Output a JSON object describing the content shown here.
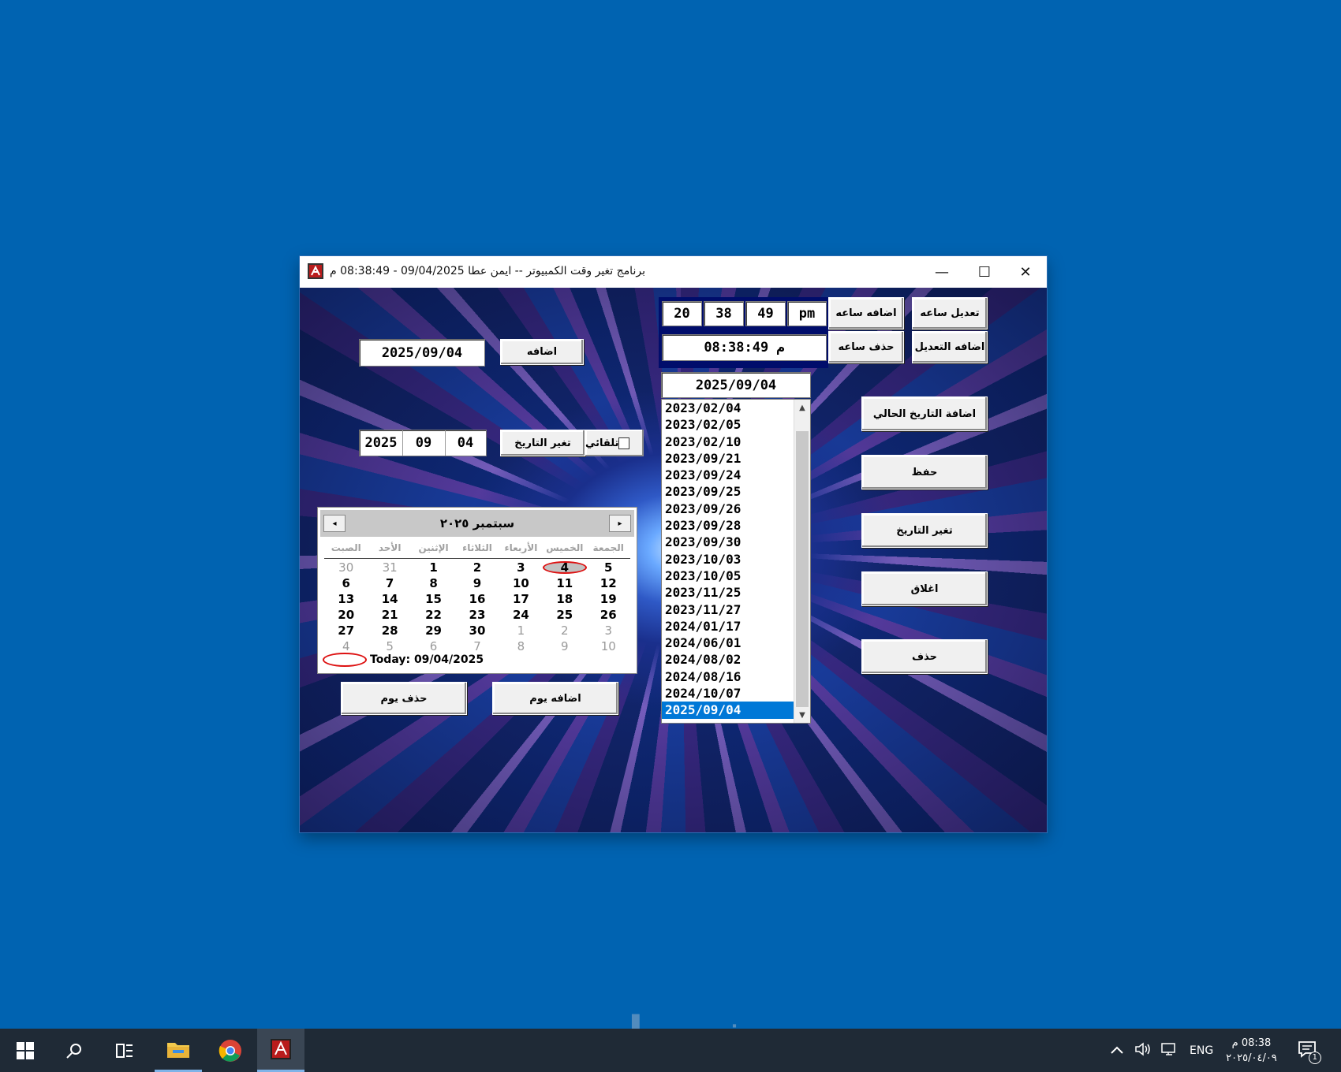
{
  "window": {
    "title": "برنامج تغير وقت الكمبيوتر  --  ايمن عطا      09/04/2025  -  08:38:49 م",
    "minimize_glyph": "—",
    "maximize_glyph": "☐",
    "close_glyph": "✕"
  },
  "left_panel": {
    "date_display": "2025/09/04",
    "add_button": "اضافه",
    "date_year": "2025",
    "date_month": "09",
    "date_day": "04",
    "change_date_button": "تغير التاريخ",
    "auto_checkbox_label": "تلقائي",
    "auto_checked": false,
    "add_day_button": "اضافه يوم",
    "remove_day_button": "حذف يوم"
  },
  "calendar": {
    "month_title": "سبتمبر ٢٠٢٥",
    "prev_glyph": "◂",
    "next_glyph": "▸",
    "weekdays": [
      "الصبت",
      "الأحد",
      "الإثنين",
      "الثلاثاء",
      "الأربعاء",
      "الخميس",
      "الجمعة"
    ],
    "weeks": [
      [
        {
          "d": "30",
          "o": true
        },
        {
          "d": "31",
          "o": true
        },
        {
          "d": "1"
        },
        {
          "d": "2"
        },
        {
          "d": "3"
        },
        {
          "d": "4",
          "t": true
        },
        {
          "d": "5"
        }
      ],
      [
        {
          "d": "6"
        },
        {
          "d": "7"
        },
        {
          "d": "8"
        },
        {
          "d": "9"
        },
        {
          "d": "10"
        },
        {
          "d": "11"
        },
        {
          "d": "12"
        }
      ],
      [
        {
          "d": "13"
        },
        {
          "d": "14"
        },
        {
          "d": "15"
        },
        {
          "d": "16"
        },
        {
          "d": "17"
        },
        {
          "d": "18"
        },
        {
          "d": "19"
        }
      ],
      [
        {
          "d": "20"
        },
        {
          "d": "21"
        },
        {
          "d": "22"
        },
        {
          "d": "23"
        },
        {
          "d": "24"
        },
        {
          "d": "25"
        },
        {
          "d": "26"
        }
      ],
      [
        {
          "d": "27"
        },
        {
          "d": "28"
        },
        {
          "d": "29"
        },
        {
          "d": "30"
        },
        {
          "d": "1",
          "o": true
        },
        {
          "d": "2",
          "o": true
        },
        {
          "d": "3",
          "o": true
        }
      ],
      [
        {
          "d": "4",
          "o": true
        },
        {
          "d": "5",
          "o": true
        },
        {
          "d": "6",
          "o": true
        },
        {
          "d": "7",
          "o": true
        },
        {
          "d": "8",
          "o": true
        },
        {
          "d": "9",
          "o": true
        },
        {
          "d": "10",
          "o": true
        }
      ]
    ],
    "today_text": "Today: 09/04/2025"
  },
  "time_panel": {
    "hour": "20",
    "minute": "38",
    "second": "49",
    "ampm": "pm",
    "time_display": "08:38:49 م",
    "add_hour_button": "اضافه ساعه",
    "edit_hour_button": "تعديل ساعه",
    "remove_hour_button": "حذف ساعه",
    "add_edit_button": "اضافه التعديل",
    "list_date_field": "2025/09/04"
  },
  "date_list": {
    "items": [
      "2023/02/04",
      "2023/02/05",
      "2023/02/10",
      "2023/09/21",
      "2023/09/24",
      "2023/09/25",
      "2023/09/26",
      "2023/09/28",
      "2023/09/30",
      "2023/10/03",
      "2023/10/05",
      "2023/11/25",
      "2023/11/27",
      "2024/01/17",
      "2024/06/01",
      "2024/08/02",
      "2024/08/16",
      "2024/10/07",
      "2025/09/04"
    ],
    "selected_index": 18
  },
  "right_buttons": {
    "add_current_date": "اضافة التاريخ الحالي",
    "save": "حفظ",
    "change_date": "تغير التاريخ",
    "close": "اغلاق",
    "delete": "حذف"
  },
  "taskbar": {
    "language": "ENG",
    "clock_time": "08:38 م",
    "clock_date": "٢٠٢٥/٠٤/٠٩",
    "notification_count": "1"
  },
  "watermark": "خمسات",
  "colors": {
    "desktop": "#0063b1",
    "taskbar": "#1f2a36",
    "selection": "#0078d7"
  }
}
